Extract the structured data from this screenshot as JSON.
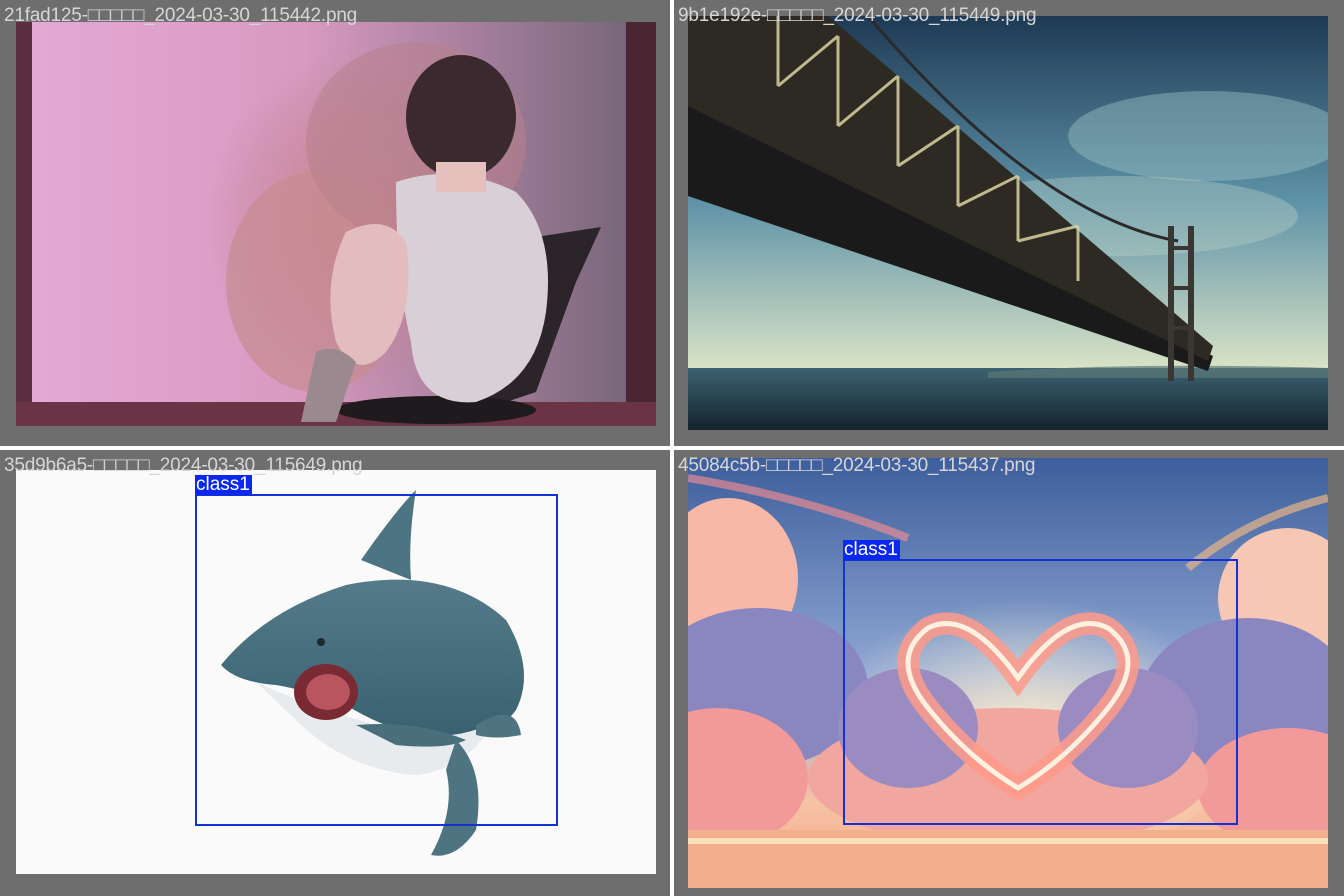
{
  "tiles": [
    {
      "filename": "21fad125-□□□□□_2024-03-30_115442.png",
      "image": "girl-by-window-pink-clouds",
      "detections": []
    },
    {
      "filename": "9b1e192e-□□□□□_2024-03-30_115449.png",
      "image": "suspension-bridge-over-sea",
      "detections": []
    },
    {
      "filename": "35d9b6a5-□□□□□_2024-03-30_115649.png",
      "image": "shark-illustration",
      "detections": [
        {
          "label": "class1"
        }
      ]
    },
    {
      "filename": "45084c5b-□□□□□_2024-03-30_115437.png",
      "image": "heart-shaped-cloud-sunset",
      "detections": [
        {
          "label": "class1"
        }
      ]
    }
  ],
  "colors": {
    "background": "#6e6e6e",
    "filename_text": "#d6d6d6",
    "bbox_border": "#1432d2",
    "bbox_label_bg": "#0a28f0",
    "bbox_label_text": "#ffffff"
  }
}
